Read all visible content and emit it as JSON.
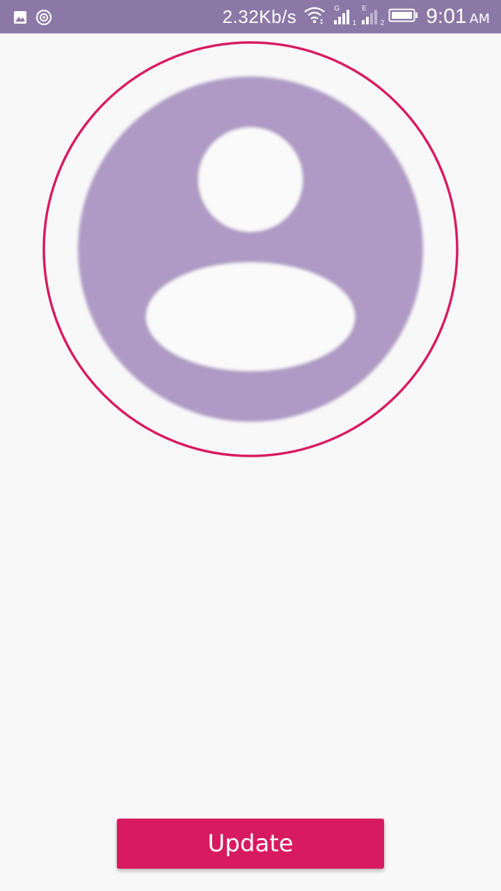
{
  "status_bar": {
    "network_speed": "2.32Kb/s",
    "time": "9:01",
    "ampm": "AM",
    "sim1_tag": "G",
    "sim1_sub": "1",
    "sim2_tag": "E",
    "sim2_sub": "2",
    "icons": [
      "gallery-icon",
      "sync-icon",
      "wifi-icon",
      "signal-sim1-icon",
      "signal-sim2-icon",
      "battery-icon"
    ]
  },
  "profile": {
    "avatar_icon": "account-circle-icon",
    "avatar_color": "#ae9ac4",
    "ring_color": "#d81b60"
  },
  "actions": {
    "update_label": "Update",
    "accent_color": "#d81b60"
  }
}
